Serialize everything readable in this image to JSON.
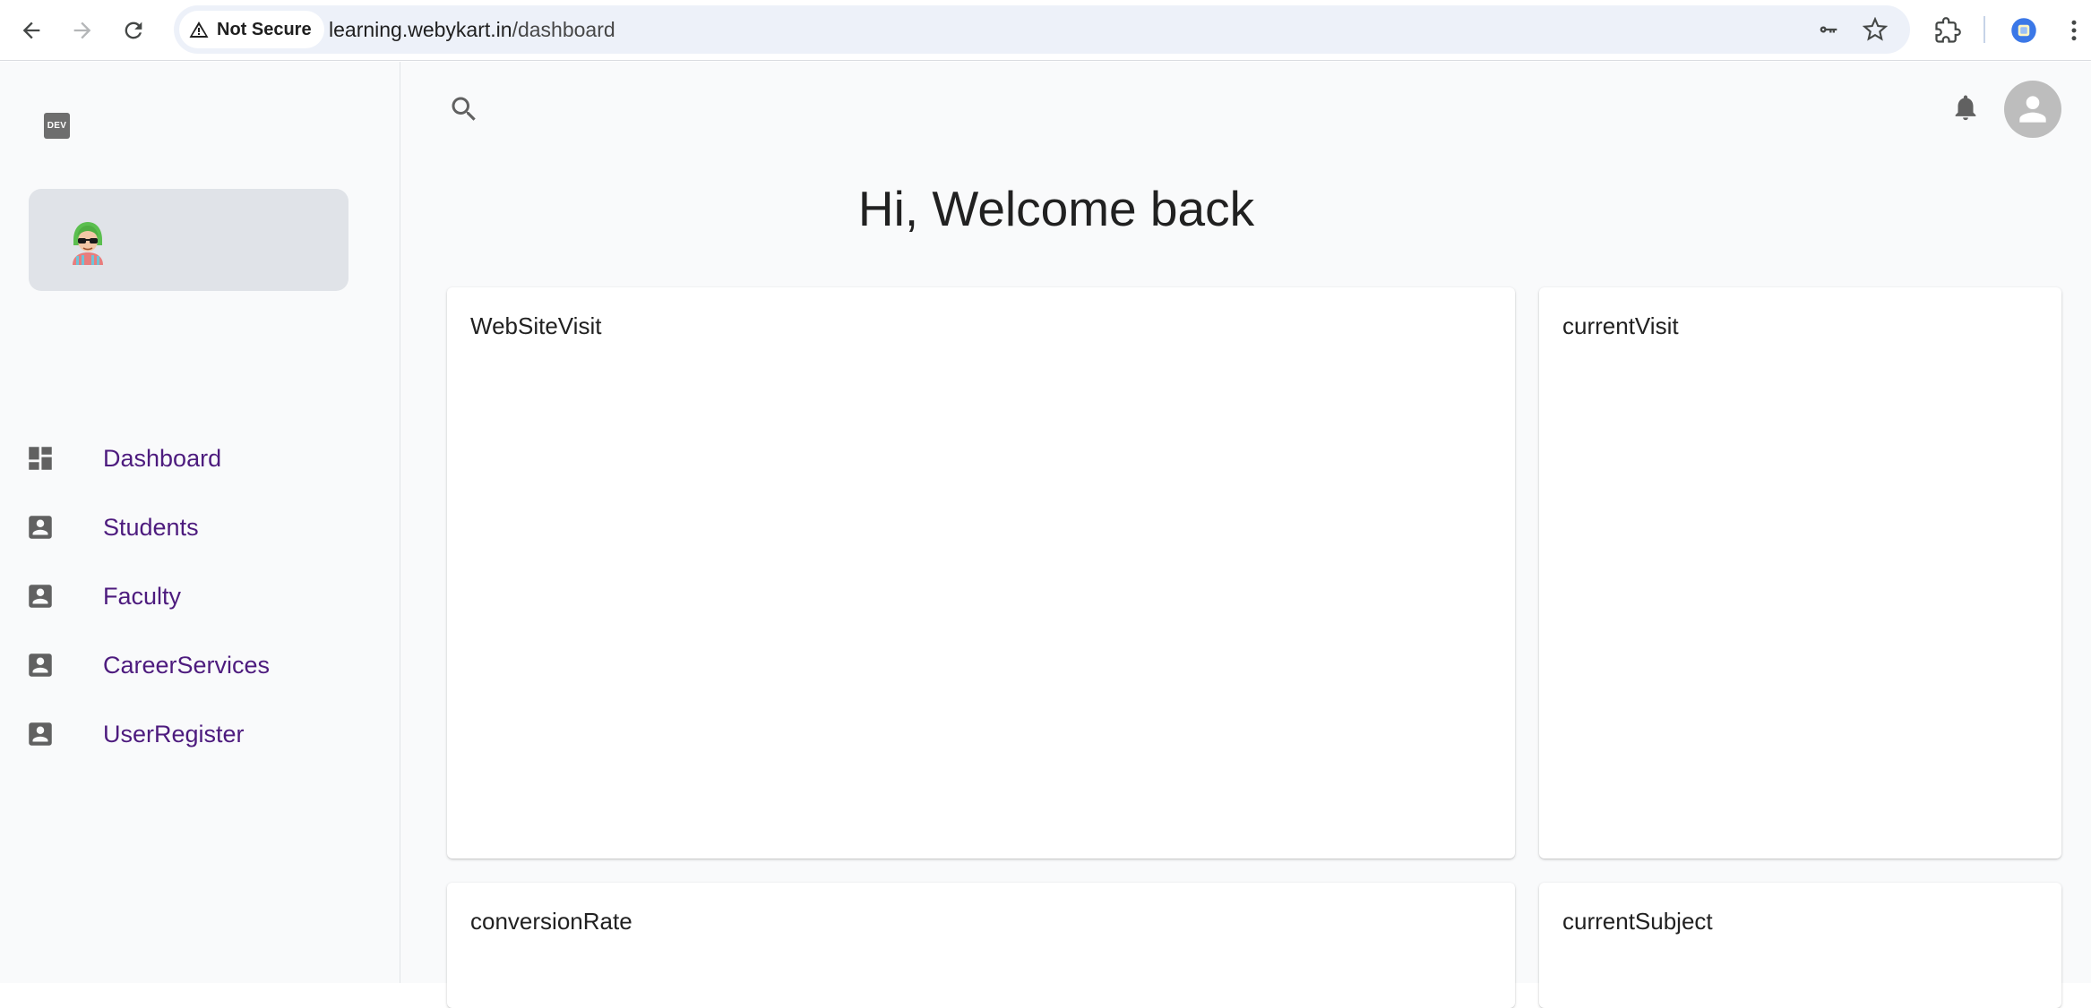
{
  "browser": {
    "security_label": "Not Secure",
    "url_host": "learning.webykart.in",
    "url_path": "/dashboard"
  },
  "sidebar": {
    "logo_text": "DEV",
    "items": [
      {
        "label": "Dashboard",
        "icon": "dashboard-icon"
      },
      {
        "label": "Students",
        "icon": "account-box-icon"
      },
      {
        "label": "Faculty",
        "icon": "account-box-icon"
      },
      {
        "label": "CareerServices",
        "icon": "account-box-icon"
      },
      {
        "label": "UserRegister",
        "icon": "account-box-icon"
      }
    ]
  },
  "header": {
    "title": "Hi, Welcome back"
  },
  "cards": [
    {
      "title": "WebSiteVisit"
    },
    {
      "title": "currentVisit"
    },
    {
      "title": "conversionRate"
    },
    {
      "title": "currentSubject"
    }
  ],
  "colors": {
    "nav_text": "#4d1b7e",
    "icon_gray": "#616161",
    "sidebar_card": "#e0e3e8",
    "page_bg": "#f9fafb",
    "omnibox_bg": "#edf1f9"
  }
}
